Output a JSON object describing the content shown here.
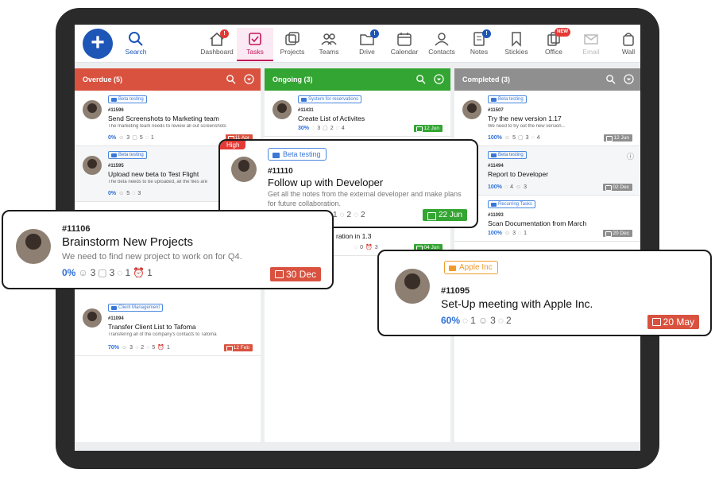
{
  "nav": {
    "search": "Search",
    "items": [
      {
        "label": "Dashboard",
        "badge": "!"
      },
      {
        "label": "Tasks"
      },
      {
        "label": "Projects"
      },
      {
        "label": "Teams"
      },
      {
        "label": "Drive",
        "badge": "!"
      },
      {
        "label": "Calendar"
      },
      {
        "label": "Contacts"
      },
      {
        "label": "Notes",
        "badge": "!"
      },
      {
        "label": "Stickies"
      },
      {
        "label": "Office",
        "badge": "NEW"
      },
      {
        "label": "Email"
      },
      {
        "label": "Wall"
      }
    ]
  },
  "columns": {
    "overdue": {
      "title": "Overdue (5)",
      "color": "#d9523f"
    },
    "ongoing": {
      "title": "Ongoing (3)",
      "color": "#33a532"
    },
    "completed": {
      "title": "Completed (3)",
      "color": "#8f8f8f"
    }
  },
  "overdue_cards": [
    {
      "tag": "Beta testing",
      "id": "#11596",
      "title": "Send Screenshots to Marketing team",
      "desc": "The marketing team needs to review all out screenshots",
      "pct": "0%",
      "s1": "3",
      "s2": "5",
      "s3": "1",
      "date": "11 Apr"
    },
    {
      "tag": "Beta testing",
      "id": "#11595",
      "title": "Upload new beta to Test Flight",
      "desc": "The beta needs to be uploaded, all the files are",
      "pct": "0%",
      "s1": "5",
      "s2": "3"
    },
    {
      "tag": "Client Management",
      "id": "#11094",
      "title": "Transfer Client List to Tafoma",
      "desc": "Transfering all of the company's contacts to Tafoma",
      "pct": "70%",
      "s1": "3",
      "s2": "2",
      "s3": "5",
      "s4": "1",
      "date": "12 Feb"
    }
  ],
  "ongoing_cards": [
    {
      "tag": "System for reservations",
      "id": "#11431",
      "title": "Create List of Activites",
      "pct": "30%",
      "s1": "3",
      "s2": "2",
      "s3": "4",
      "date": "12 Jun"
    },
    {
      "title": "ration in 1.3",
      "s1": "0",
      "s2": "3",
      "date": "04 Jun"
    }
  ],
  "completed_cards": [
    {
      "tag": "Beta testing",
      "id": "#11507",
      "title": "Try the new version 1.17",
      "desc": "We need to try out the new version...",
      "pct": "100%",
      "s1": "5",
      "s2": "3",
      "s3": "4",
      "date": "12 Jun"
    },
    {
      "tag": "Beta testing",
      "id": "#11494",
      "title": "Report to Developer",
      "pct": "100%",
      "s1": "4",
      "s2": "3",
      "date": "02 Dec"
    },
    {
      "tag": "Recurring Tasks",
      "id": "#11093",
      "title": "Scan Documentation from March",
      "pct": "100%",
      "s1": "3",
      "s2": "1",
      "date": "20 Dec"
    }
  ],
  "popup_follow": {
    "priority": "High",
    "tag": "Beta testing",
    "id": "#11110",
    "title": "Follow up with Developer",
    "desc": "Get all the notes from the external developer and make plans for future collaboration.",
    "s1": "1",
    "s2": "2",
    "s3": "2",
    "date": "22 Jun"
  },
  "popup_brainstorm": {
    "id": "#11106",
    "title": "Brainstorm New Projects",
    "desc": "We need to find new project to work on for Q4.",
    "pct": "0%",
    "s1": "3",
    "s2": "3",
    "s3": "1",
    "s4": "1",
    "date": "30 Dec"
  },
  "popup_apple": {
    "tag": "Apple Inc",
    "id": "#11095",
    "title": "Set-Up meeting with Apple Inc.",
    "pct": "60%",
    "s1": "1",
    "s2": "3",
    "s3": "2",
    "date": "20 May"
  }
}
